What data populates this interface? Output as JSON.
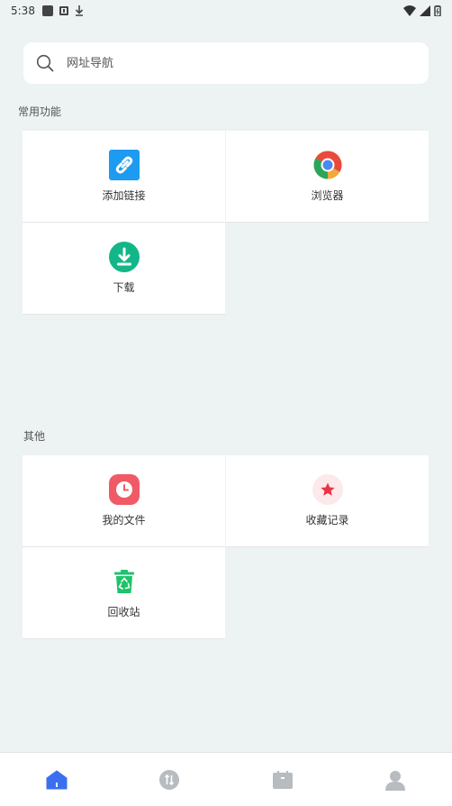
{
  "status_bar": {
    "time": "5:38"
  },
  "search": {
    "placeholder": "网址导航"
  },
  "sections": {
    "common": {
      "title": "常用功能",
      "tiles": [
        {
          "label": "添加链接",
          "icon": "link-icon"
        },
        {
          "label": "浏览器",
          "icon": "chrome-browser-icon"
        },
        {
          "label": "下载",
          "icon": "download-icon"
        }
      ]
    },
    "other": {
      "title": "其他",
      "tiles": [
        {
          "label": "我的文件",
          "icon": "clock-file-icon"
        },
        {
          "label": "收藏记录",
          "icon": "star-icon"
        },
        {
          "label": "回收站",
          "icon": "recycle-bin-icon"
        }
      ]
    }
  },
  "bottom_nav": [
    {
      "name": "home",
      "icon": "home-icon",
      "active": true
    },
    {
      "name": "transfer",
      "icon": "transfer-icon",
      "active": false
    },
    {
      "name": "toolbox",
      "icon": "toolbox-icon",
      "active": false
    },
    {
      "name": "profile",
      "icon": "profile-icon",
      "active": false
    }
  ],
  "colors": {
    "background": "#edf2f3",
    "accent": "#3a6ff0",
    "link_blue": "#1d9bf0",
    "download_green": "#13b688",
    "file_red": "#f05a66",
    "star_red": "#e8344a",
    "recycle_green": "#1ec36b"
  }
}
